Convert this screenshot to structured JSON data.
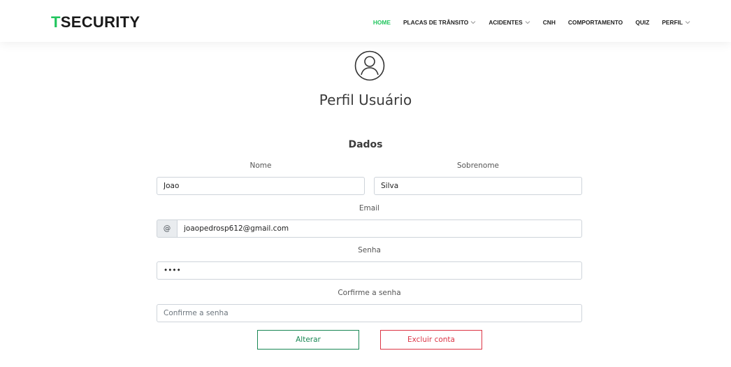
{
  "brand": {
    "accent_letter": "T",
    "rest": "SECURITY",
    "accent_color": "#22c55e"
  },
  "nav": {
    "items": [
      {
        "label": "HOME",
        "active": true,
        "has_dropdown": false
      },
      {
        "label": "PLACAS DE TRÂNSITO",
        "active": false,
        "has_dropdown": true
      },
      {
        "label": "ACIDENTES",
        "active": false,
        "has_dropdown": true
      },
      {
        "label": "CNH",
        "active": false,
        "has_dropdown": false
      },
      {
        "label": "COMPORTAMENTO",
        "active": false,
        "has_dropdown": false
      },
      {
        "label": "QUIZ",
        "active": false,
        "has_dropdown": false
      },
      {
        "label": "PERFIL",
        "active": false,
        "has_dropdown": true
      }
    ]
  },
  "profile": {
    "icon": "user-circle-icon",
    "title": "Perfil Usuário",
    "section_title": "Dados"
  },
  "form": {
    "nome": {
      "label": "Nome",
      "value": "Joao"
    },
    "sobrenome": {
      "label": "Sobrenome",
      "value": "Silva"
    },
    "email": {
      "label": "Email",
      "addon": "@",
      "value": "joaopedrosp612@gmail.com"
    },
    "senha": {
      "label": "Senha",
      "value": "abcd"
    },
    "confirmar": {
      "label": "Corfirme a senha",
      "placeholder": "Confirme a senha",
      "value": ""
    }
  },
  "buttons": {
    "alterar": {
      "label": "Alterar",
      "color": "#198754"
    },
    "excluir": {
      "label": "Excluir conta",
      "color": "#dc3545"
    }
  }
}
